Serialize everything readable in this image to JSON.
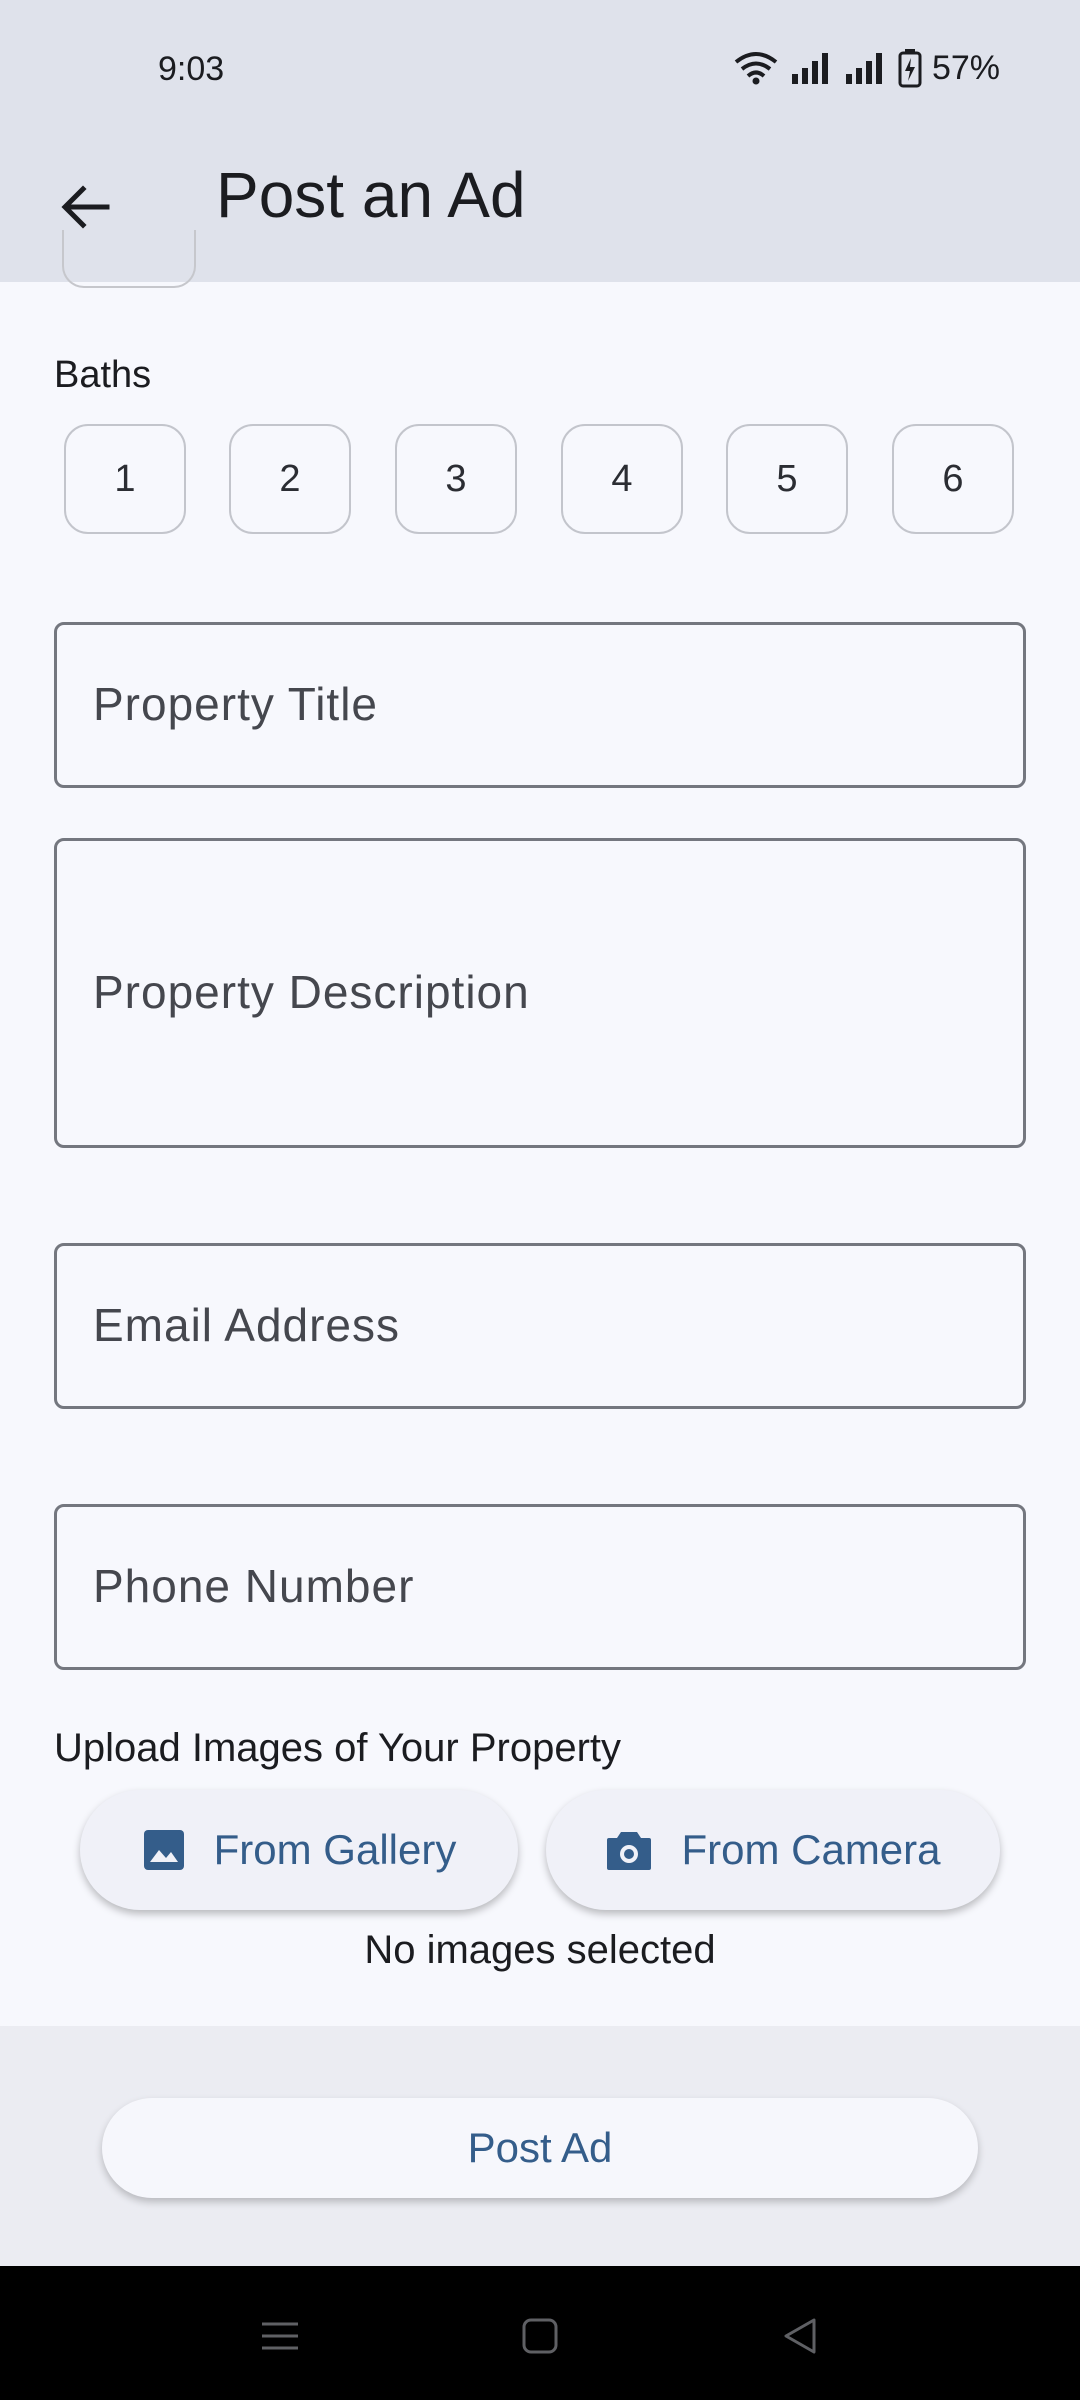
{
  "status_bar": {
    "time": "9:03",
    "battery": "57%"
  },
  "app_bar": {
    "title": "Post an Ad"
  },
  "baths": {
    "label": "Baths",
    "options": [
      "1",
      "2",
      "3",
      "4",
      "5",
      "6"
    ]
  },
  "fields": {
    "title_placeholder": "Property Title",
    "description_placeholder": "Property Description",
    "email_placeholder": "Email Address",
    "phone_placeholder": "Phone Number"
  },
  "upload": {
    "label": "Upload Images of Your Property",
    "gallery_label": "From Gallery",
    "camera_label": "From Camera",
    "status": "No images selected"
  },
  "post_button": "Post Ad",
  "colors": {
    "accent": "#345d8a",
    "app_bar": "#dfe2eb",
    "background": "#f7f8fd"
  }
}
